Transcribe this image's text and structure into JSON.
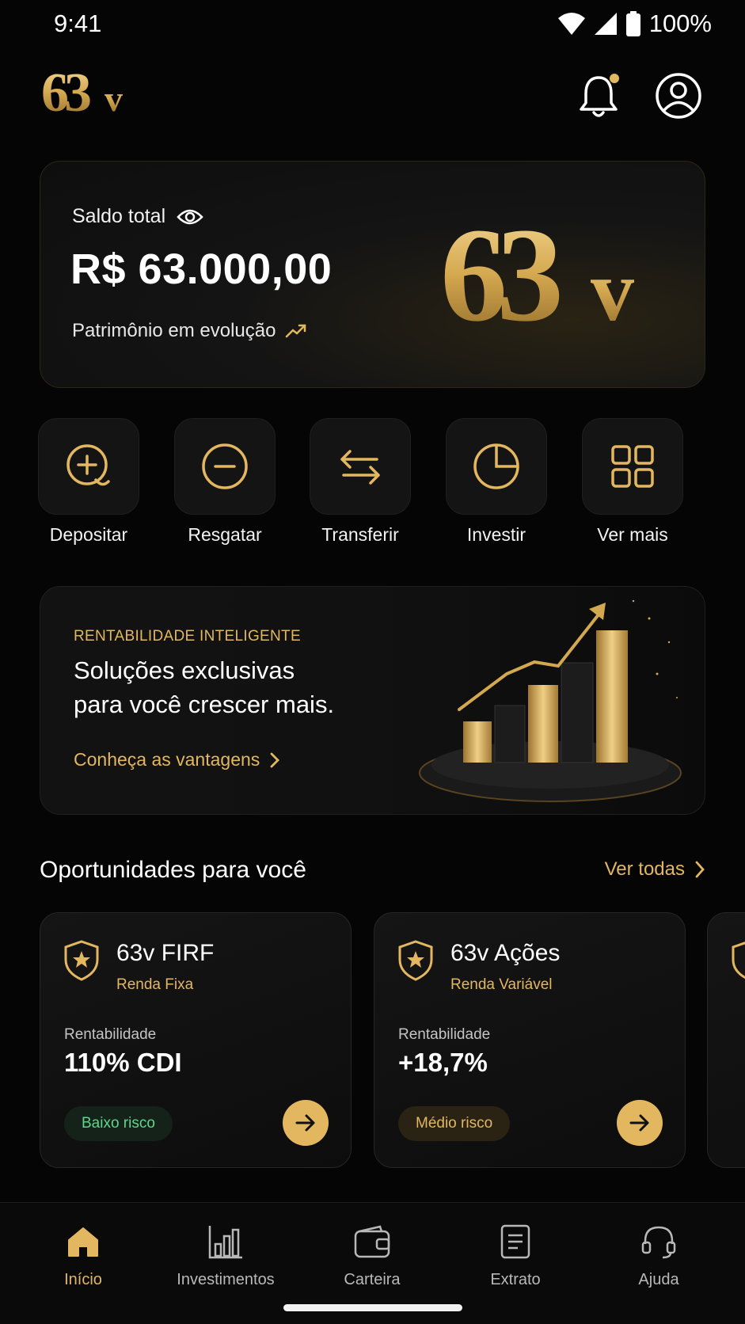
{
  "status": {
    "time": "9:41",
    "battery": "100%"
  },
  "brand": {
    "logo_text": "63v",
    "accent": "#e3b75f"
  },
  "header": {
    "notification_icon": "bell-icon",
    "profile_icon": "user-circle-icon"
  },
  "balance": {
    "label": "Saldo total",
    "value": "R$ 63.000,00",
    "subtitle": "Patrimônio em evolução"
  },
  "actions": [
    {
      "label": "Depositar",
      "icon": "plus-circle-icon"
    },
    {
      "label": "Resgatar",
      "icon": "minus-circle-icon"
    },
    {
      "label": "Transferir",
      "icon": "transfer-arrows-icon"
    },
    {
      "label": "Investir",
      "icon": "pie-chart-icon"
    },
    {
      "label": "Ver mais",
      "icon": "grid-icon"
    }
  ],
  "promo": {
    "tag": "RENTABILIDADE INTELIGENTE",
    "title_line1": "Soluções exclusivas",
    "title_line2": "para você crescer mais.",
    "link": "Conheça as vantagens"
  },
  "opportunities": {
    "title": "Oportunidades para você",
    "see_all": "Ver todas",
    "cards": [
      {
        "name": "63v FIRF",
        "type": "Renda Fixa",
        "return_label": "Rentabilidade",
        "return_value": "110% CDI",
        "risk": "Baixo risco",
        "risk_color": "#5fd68c"
      },
      {
        "name": "63v Ações",
        "type": "Renda Variável",
        "return_label": "Rentabilidade",
        "return_value": "+18,7%",
        "risk": "Médio risco",
        "risk_color": "#e3b75f"
      }
    ]
  },
  "nav": [
    {
      "label": "Início",
      "icon": "home-icon",
      "active": true
    },
    {
      "label": "Investimentos",
      "icon": "bar-chart-icon",
      "active": false
    },
    {
      "label": "Carteira",
      "icon": "wallet-icon",
      "active": false
    },
    {
      "label": "Extrato",
      "icon": "document-icon",
      "active": false
    },
    {
      "label": "Ajuda",
      "icon": "headset-icon",
      "active": false
    }
  ]
}
